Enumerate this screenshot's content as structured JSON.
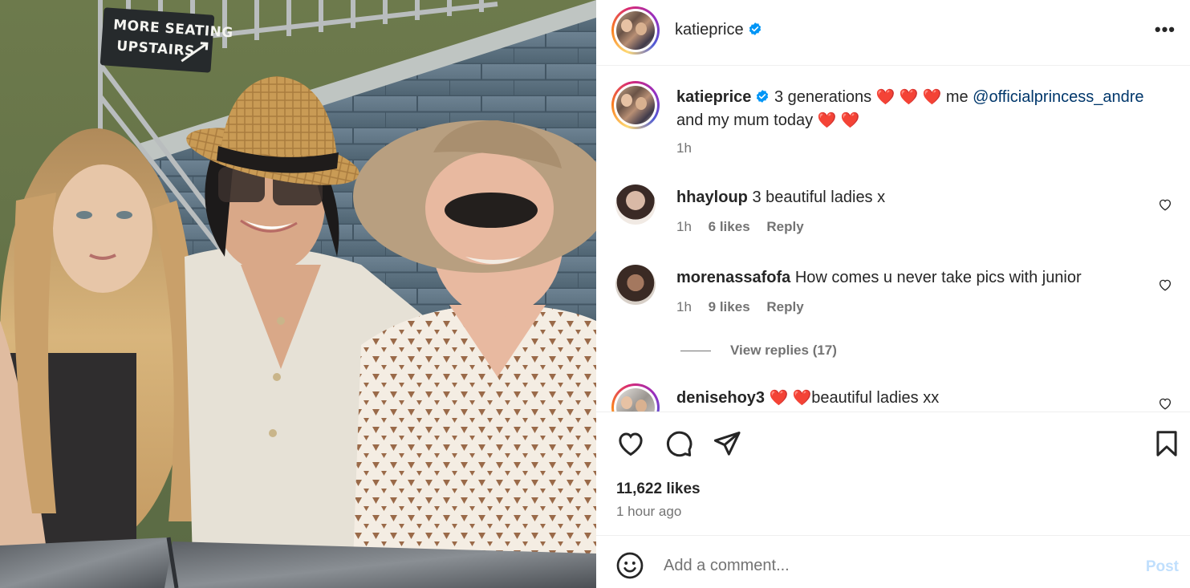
{
  "photo": {
    "sign_line1": "MORE SEATING",
    "sign_line2": "UPSTAIRS"
  },
  "post": {
    "author": "katieprice",
    "verified": true,
    "more_icon": "more-horizontal-icon"
  },
  "caption": {
    "author": "katieprice",
    "text_part1": "3 generations",
    "hearts1": "❤️ ❤️ ❤️",
    "text_part2": "me",
    "mention": "@officialprincess_andre",
    "text_part3": "and my mum today",
    "hearts2": "❤️ ❤️",
    "time": "1h"
  },
  "comments": [
    {
      "username": "hhayloup",
      "text": "3 beautiful ladies x",
      "time": "1h",
      "likes": "6 likes",
      "reply": "Reply"
    },
    {
      "username": "morenassafofa",
      "text": "How comes u never take pics with junior",
      "time": "1h",
      "likes": "9 likes",
      "reply": "Reply",
      "view_replies": "View replies (17)"
    },
    {
      "username": "denisehoy3",
      "hearts": "❤️ ❤️",
      "text": "beautiful ladies xx"
    }
  ],
  "actions": {
    "like_icon": "heart-icon",
    "comment_icon": "comment-icon",
    "share_icon": "share-icon",
    "save_icon": "bookmark-icon",
    "likes": "11,622 likes",
    "posted": "1 hour ago"
  },
  "composer": {
    "emoji_icon": "emoji-icon",
    "placeholder": "Add a comment...",
    "post_label": "Post"
  },
  "colors": {
    "link": "#00376b",
    "muted": "#737373",
    "verified": "#0095f6",
    "heart": "#e0102b",
    "post_disabled": "#c0dffd"
  }
}
